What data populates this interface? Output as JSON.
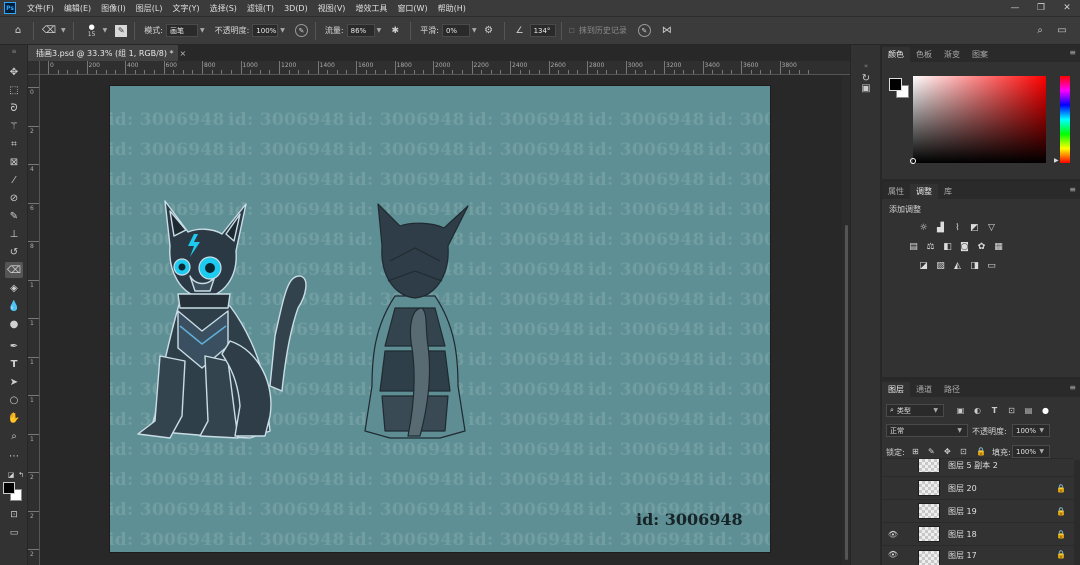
{
  "app": {
    "logo": "Ps"
  },
  "menu": [
    "文件(F)",
    "编辑(E)",
    "图像(I)",
    "图层(L)",
    "文字(Y)",
    "选择(S)",
    "滤镜(T)",
    "3D(D)",
    "视图(V)",
    "增效工具",
    "窗口(W)",
    "帮助(H)"
  ],
  "window_controls": {
    "minimize": "—",
    "maximize": "❐",
    "close": "✕"
  },
  "options": {
    "brush_size": "15",
    "mode_label": "模式:",
    "mode_value": "画笔",
    "opacity_label": "不透明度:",
    "opacity_value": "100%",
    "flow_label": "流量:",
    "flow_value": "86%",
    "smooth_label": "平滑:",
    "smooth_value": "0%",
    "angle_value": "134°",
    "erase_history": "抹到历史记录"
  },
  "document_tab": {
    "title": "插画3.psd @ 33.3% (组 1, RGB/8) *",
    "close": "×"
  },
  "ruler": {
    "h_labels": [
      "0",
      "200",
      "400",
      "600",
      "800",
      "1000",
      "1200",
      "1400",
      "1600",
      "1800",
      "2000",
      "2200",
      "2400",
      "2600",
      "2800",
      "3000",
      "3200",
      "3400",
      "3600",
      "3800"
    ],
    "v_labels": [
      "0",
      "2",
      "4",
      "6",
      "8",
      "1",
      "1",
      "1",
      "1",
      "1",
      "2",
      "2",
      "2"
    ]
  },
  "canvas": {
    "background": "#5d8f94",
    "watermark_text": "id: 3006948",
    "id_label": "id: 3006948"
  },
  "color_panel": {
    "tabs": [
      "颜色",
      "色板",
      "渐变",
      "图案"
    ],
    "active_tab": "颜色",
    "foreground": "#000000",
    "background": "#ffffff"
  },
  "adjust_panel": {
    "tabs": [
      "属性",
      "调整",
      "库"
    ],
    "active_tab": "调整",
    "title": "添加调整"
  },
  "layers_panel": {
    "tabs": [
      "图层",
      "通道",
      "路径"
    ],
    "active_tab": "图层",
    "filter_kind": "类型",
    "blend_mode": "正常",
    "opacity_label": "不透明度:",
    "opacity_value": "100%",
    "lock_label": "锁定:",
    "fill_label": "填充:",
    "fill_value": "100%",
    "layers": [
      {
        "name": "图层 5 副本 2",
        "visible": false,
        "locked": false
      },
      {
        "name": "图层 20",
        "visible": false,
        "locked": true
      },
      {
        "name": "图层 19",
        "visible": false,
        "locked": true
      },
      {
        "name": "图层 18",
        "visible": true,
        "locked": true
      },
      {
        "name": "图层 17",
        "visible": true,
        "locked": true
      }
    ]
  }
}
